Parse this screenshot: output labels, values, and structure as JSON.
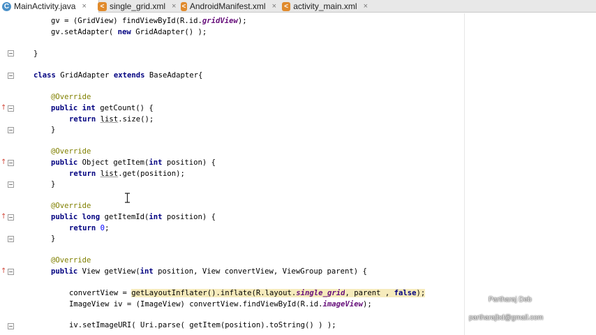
{
  "tabs": [
    {
      "label": "MainActivity.java",
      "type": "java",
      "active": true
    },
    {
      "label": "single_grid.xml",
      "type": "xml",
      "active": false
    },
    {
      "label": "AndroidManifest.xml",
      "type": "xml",
      "active": false
    },
    {
      "label": "activity_main.xml",
      "type": "xml",
      "active": false
    }
  ],
  "tab_close_glyph": "×",
  "watermark": {
    "name": "Partharaj Deb",
    "email": "partharajbd@gmail.com"
  },
  "code": {
    "l1_a": "gv = (GridView) findViewById(R.id.",
    "l1_b": "gridView",
    "l1_c": ");",
    "l2_a": "gv.setAdapter( ",
    "l2_kw": "new",
    "l2_b": " GridAdapter() );",
    "l3": "}",
    "l4_kw1": "class",
    "l4_a": " GridAdapter ",
    "l4_kw2": "extends",
    "l4_b": " BaseAdapter{",
    "ann": "@Override",
    "c1_kw1": "public",
    "c1_kw2": "int",
    "c1_a": " getCount() {",
    "ret": "return",
    "c1_body_a": " ",
    "c1_body_list": "list",
    "c1_body_b": ".size();",
    "close": "}",
    "c2_kw1": "public",
    "c2_a": " Object getItem(",
    "c2_kw2": "int",
    "c2_b": " position) {",
    "c2_body_b": ".get(position);",
    "c3_kw1": "public",
    "c3_kw2": "long",
    "c3_a": " getItemId(",
    "c3_kw3": "int",
    "c3_b": " position) {",
    "c3_num": "0",
    "c3_semi": ";",
    "c4_kw1": "public",
    "c4_a": " View getView(",
    "c4_kw2": "int",
    "c4_b": " position, View convertView, ViewGroup parent) {",
    "c4_l1_a": "convertView = ",
    "c4_l1_hl": "getLayoutInflater()",
    "c4_l1_b": ".inflate(R.layout.",
    "c4_l1_fld": "single_grid",
    "c4_l1_c": ", parent , ",
    "c4_l1_kw": "false",
    "c4_l1_d": ");",
    "c4_l2_a": "ImageView iv = (ImageView) convertView.findViewById(R.id.",
    "c4_l2_fld": "imageView",
    "c4_l2_b": ");",
    "c4_l3": "iv.setImageURI( Uri.parse( getItem(position).toString() ) );"
  }
}
